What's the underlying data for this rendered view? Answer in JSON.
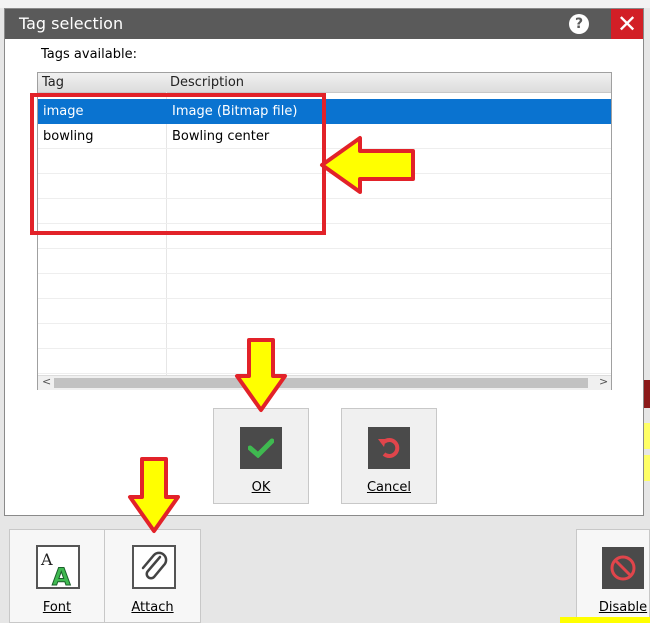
{
  "dialog": {
    "title": "Tag selection",
    "tags_label": "Tags available:"
  },
  "table": {
    "columns": [
      "Tag",
      "Description"
    ],
    "rows": [
      {
        "tag": "image",
        "description": "Image (Bitmap file)",
        "selected": true
      },
      {
        "tag": "bowling",
        "description": "Bowling center",
        "selected": false
      }
    ]
  },
  "buttons": {
    "ok": "OK",
    "cancel": "Cancel"
  },
  "toolbar": {
    "font": "Font",
    "attach": "Attach",
    "disable": "Disable"
  },
  "colors": {
    "selection": "#0a73d0",
    "annotation_red": "#e22229",
    "arrow_yellow": "#ffff00",
    "ok_check": "#3fb950",
    "cancel_undo": "#e0454b"
  }
}
